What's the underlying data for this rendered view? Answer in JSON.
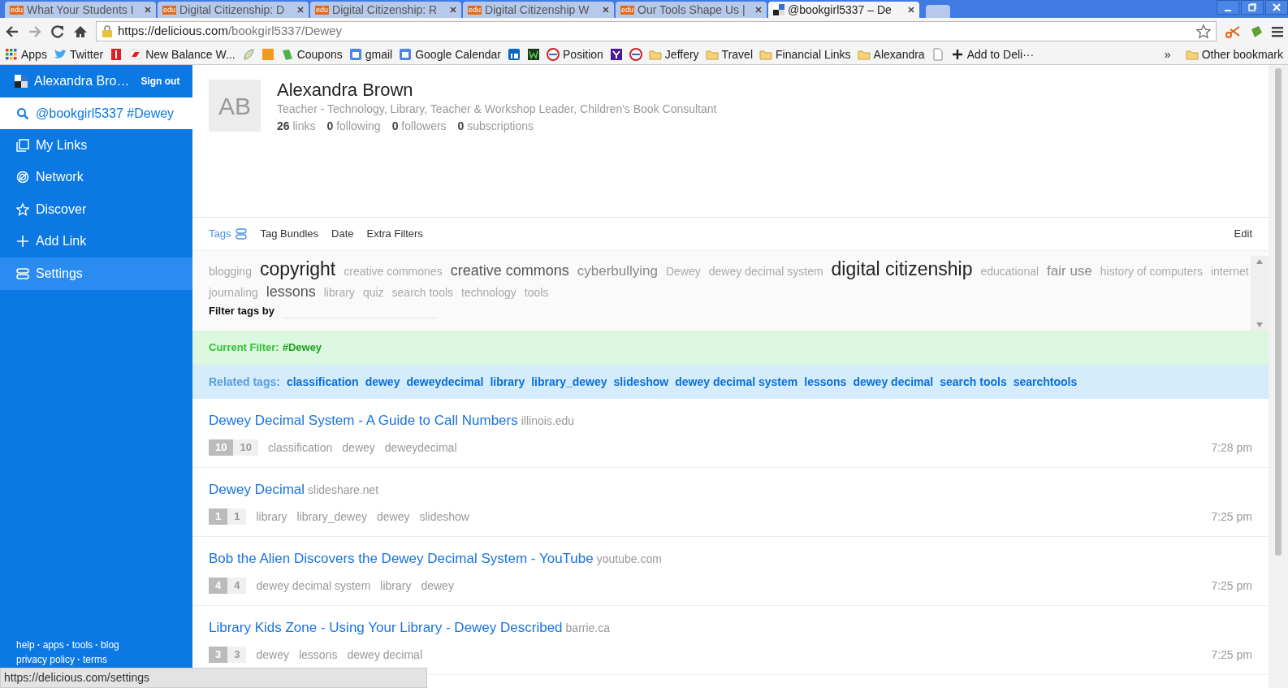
{
  "browser": {
    "tabs": [
      {
        "title": "What Your Students I",
        "badge": "edu",
        "selected": false
      },
      {
        "title": "Digital Citizenship: D",
        "badge": "edu",
        "selected": false
      },
      {
        "title": "Digital Citizenship: R",
        "badge": "edu",
        "selected": false
      },
      {
        "title": "Digital Citizenship W",
        "badge": "edu",
        "selected": false
      },
      {
        "title": "Our Tools Shape Us |",
        "badge": "edu",
        "selected": false
      },
      {
        "title": "@bookgirl5337 – De",
        "selected": true
      }
    ],
    "url": {
      "host": "https://delicious.com",
      "path": "/bookgirl5337/Dewey"
    },
    "bookmarks": [
      {
        "kind": "grid",
        "label": "Apps"
      },
      {
        "kind": "bird",
        "label": "Twitter"
      },
      {
        "kind": "bottle"
      },
      {
        "kind": "shoe",
        "label": "New Balance W..."
      },
      {
        "kind": "leaf"
      },
      {
        "kind": "square"
      },
      {
        "kind": "tag",
        "label": "Coupons"
      },
      {
        "kind": "calendar",
        "label": "gmail"
      },
      {
        "kind": "calendar",
        "label": "Google Calendar"
      },
      {
        "kind": "block"
      },
      {
        "kind": "zigzag"
      },
      {
        "kind": "circle",
        "label": "Position"
      },
      {
        "kind": "letter"
      },
      {
        "kind": "circle"
      },
      {
        "kind": "folder",
        "label": "Jeffery"
      },
      {
        "kind": "folder",
        "label": "Travel"
      },
      {
        "kind": "folder",
        "label": "Financial Links"
      },
      {
        "kind": "folder",
        "label": "Alexandra"
      },
      {
        "kind": "page"
      },
      {
        "kind": "plus",
        "label": "Add to Deli···"
      }
    ],
    "more": "»",
    "other": "Other bookmark"
  },
  "sidebar": {
    "user": "Alexandra Bro…",
    "sign_out": "Sign out",
    "search": "@bookgirl5337 #Dewey",
    "items": [
      {
        "kind": "links",
        "label": "My Links",
        "selected": false
      },
      {
        "kind": "network",
        "label": "Network",
        "selected": false
      },
      {
        "kind": "star",
        "label": "Discover",
        "selected": false
      },
      {
        "kind": "plus",
        "label": "Add Link",
        "selected": false
      },
      {
        "kind": "settings",
        "label": "Settings",
        "selected": true
      }
    ],
    "footer_separator": "·",
    "footer": [
      [
        "help",
        "apps",
        "tools",
        "blog"
      ],
      [
        "privacy policy",
        "terms"
      ]
    ]
  },
  "profile": {
    "initials": "AB",
    "name": "Alexandra Brown",
    "bio": "Teacher - Technology, Library, Teacher & Workshop Leader, Children's Book Consultant",
    "stats": [
      {
        "count": "26",
        "label": "links"
      },
      {
        "count": "0",
        "label": "following"
      },
      {
        "count": "0",
        "label": "followers"
      },
      {
        "count": "0",
        "label": "subscriptions"
      }
    ]
  },
  "filter_tabs": [
    {
      "label": "Tags",
      "selected": true
    },
    {
      "label": "Tag Bundles",
      "selected": false
    },
    {
      "label": "Date",
      "selected": false
    },
    {
      "label": "Extra Filters",
      "selected": false
    }
  ],
  "edit": "Edit",
  "tag_cloud": [
    {
      "label": "blogging",
      "kind": "small"
    },
    {
      "label": "copyright",
      "kind": "huge"
    },
    {
      "label": "creative commones",
      "kind": "small"
    },
    {
      "label": "creative commons",
      "kind": "large"
    },
    {
      "label": "cyberbullying",
      "kind": "medium"
    },
    {
      "label": "Dewey",
      "kind": "small"
    },
    {
      "label": "dewey decimal system",
      "kind": "small"
    },
    {
      "label": "digital citizenship",
      "kind": "huge"
    },
    {
      "label": "educational",
      "kind": "small"
    },
    {
      "label": "fair use",
      "kind": "medium"
    },
    {
      "label": "history of computers",
      "kind": "small"
    },
    {
      "label": "internet",
      "kind": "small"
    },
    {
      "label": "journaling",
      "kind": "small"
    },
    {
      "label": "lessons",
      "kind": "large"
    },
    {
      "label": "library",
      "kind": "small"
    },
    {
      "label": "quiz",
      "kind": "small"
    },
    {
      "label": "search tools",
      "kind": "small"
    },
    {
      "label": "technology",
      "kind": "small"
    },
    {
      "label": "tools",
      "kind": "small"
    }
  ],
  "filter_tags_label": "Filter tags by",
  "current_filter": {
    "label": "Current Filter:",
    "value": "#Dewey"
  },
  "related": {
    "label": "Related tags:",
    "tags": [
      "classification",
      "dewey",
      "deweydecimal",
      "library",
      "library_dewey",
      "slideshow",
      "dewey decimal system",
      "lessons",
      "dewey decimal",
      "search tools",
      "searchtools"
    ]
  },
  "links": [
    {
      "title": "Dewey Decimal System - A Guide to Call Numbers",
      "domain": "illinois.edu",
      "saves": "10",
      "count": "10",
      "tags": [
        "classification",
        "dewey",
        "deweydecimal"
      ],
      "time": "7:28 pm"
    },
    {
      "title": "Dewey Decimal",
      "domain": "slideshare.net",
      "saves": "1",
      "count": "1",
      "tags": [
        "library",
        "library_dewey",
        "dewey",
        "slideshow"
      ],
      "time": "7:25 pm"
    },
    {
      "title": "Bob the Alien Discovers the Dewey Decimal System - YouTube",
      "domain": "youtube.com",
      "saves": "4",
      "count": "4",
      "tags": [
        "dewey decimal system",
        "library",
        "dewey"
      ],
      "time": "7:25 pm"
    },
    {
      "title": "Library Kids Zone - Using Your Library - Dewey Described",
      "domain": "barrie.ca",
      "saves": "3",
      "count": "3",
      "tags": [
        "dewey",
        "lessons",
        "dewey decimal"
      ],
      "time": "7:25 pm"
    }
  ],
  "status_bar": "https://delicious.com/settings"
}
